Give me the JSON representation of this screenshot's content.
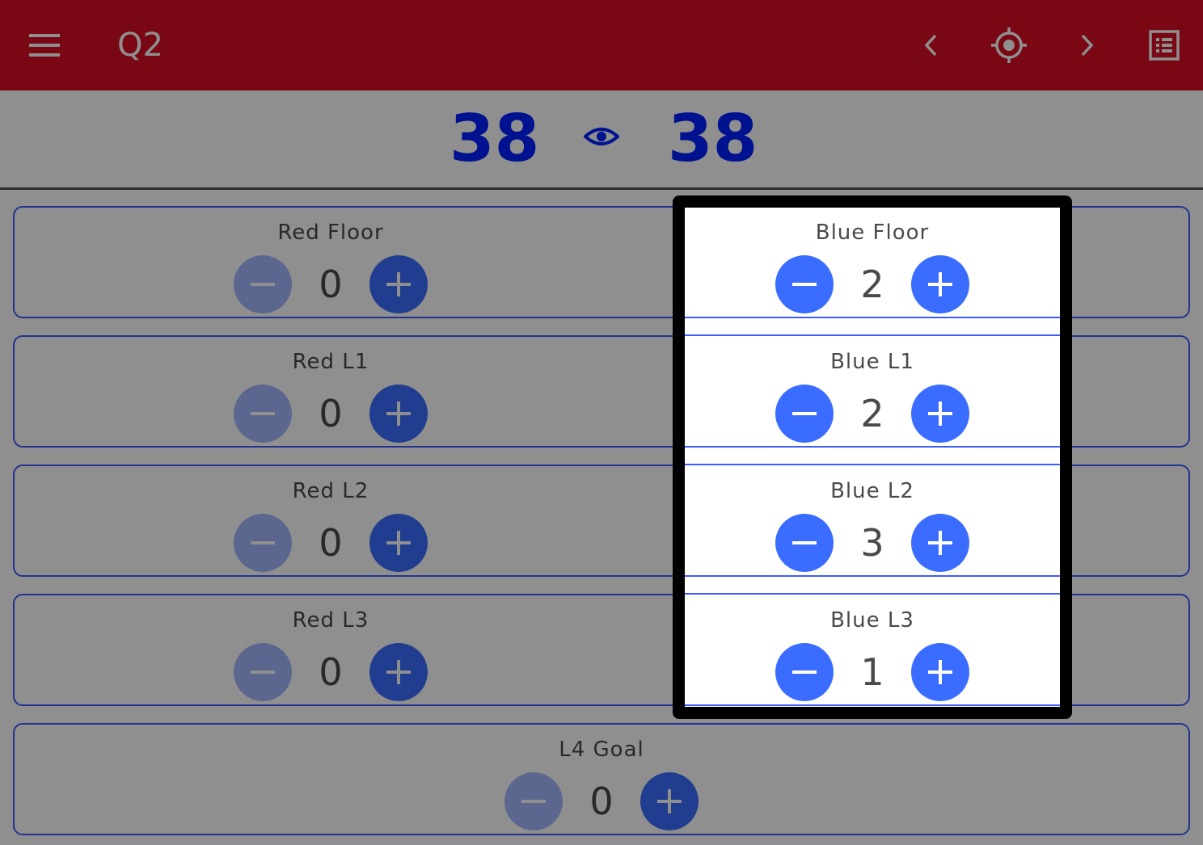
{
  "header": {
    "title": "Q2",
    "icons": [
      "menu-icon",
      "chevron-left-icon",
      "crosshair-icon",
      "chevron-right-icon",
      "list-icon"
    ]
  },
  "scores": {
    "red": "38",
    "blue": "38"
  },
  "counters": {
    "red_floor": {
      "label": "Red Floor",
      "value": "0"
    },
    "red_l1": {
      "label": "Red L1",
      "value": "0"
    },
    "red_l2": {
      "label": "Red L2",
      "value": "0"
    },
    "red_l3": {
      "label": "Red L3",
      "value": "0"
    },
    "blue_floor": {
      "label": "Blue Floor",
      "value": "2"
    },
    "blue_l1": {
      "label": "Blue L1",
      "value": "2"
    },
    "blue_l2": {
      "label": "Blue L2",
      "value": "3"
    },
    "blue_l3": {
      "label": "Blue L3",
      "value": "1"
    },
    "l4_goal": {
      "label": "L4 Goal",
      "value": "0"
    }
  },
  "colors": {
    "appbar": "#d80f25",
    "score": "#0020ff",
    "button": "#3a6dff",
    "button_disabled": "#a4b8ff",
    "card_border": "#3d5cff"
  }
}
